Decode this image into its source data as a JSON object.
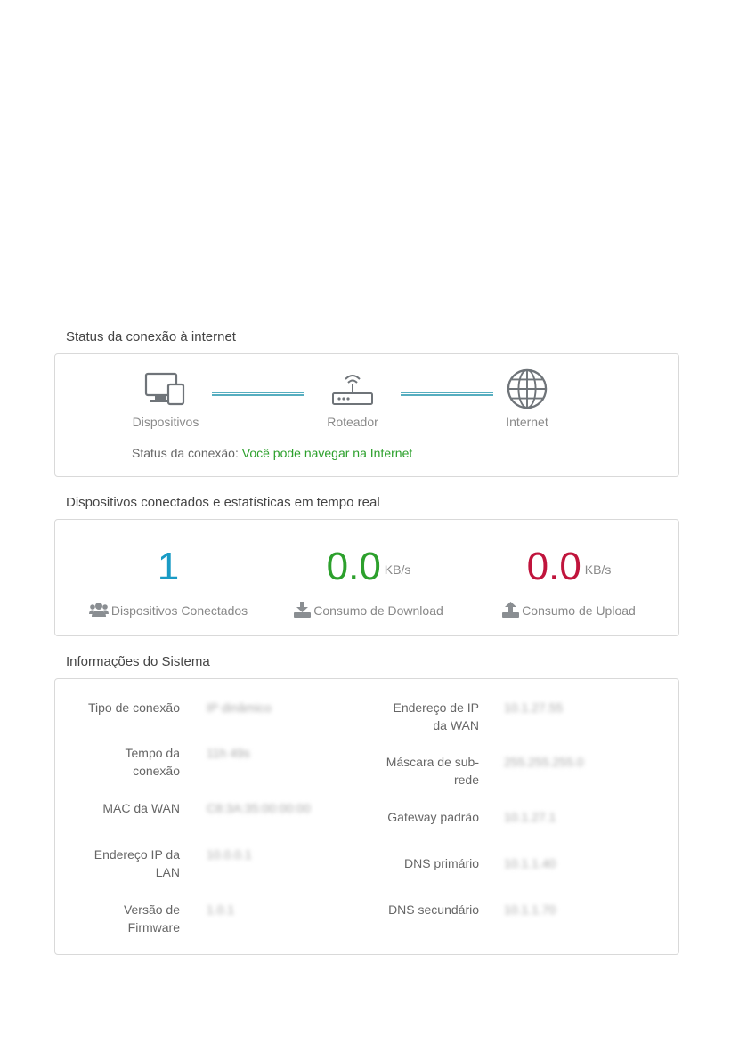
{
  "connection_status": {
    "title": "Status da conexão à internet",
    "devices_label": "Dispositivos",
    "router_label": "Roteador",
    "internet_label": "Internet",
    "status_prefix": "Status da conexão:",
    "status_value": "Você pode navegar na Internet",
    "status_color": "#2ca02c",
    "link_color": "#3aa1b6"
  },
  "stats": {
    "title": "Dispositivos conectados e estatísticas em tempo real",
    "connected": {
      "value": "1",
      "caption": "Dispositivos Conectados",
      "color": "#1a9bc5",
      "icon": "users-icon"
    },
    "download": {
      "value": "0.0",
      "unit": "KB/s",
      "caption": "Consumo de Download",
      "color": "#2ca02c",
      "icon": "download-icon"
    },
    "upload": {
      "value": "0.0",
      "unit": "KB/s",
      "caption": "Consumo de Upload",
      "color": "#c0143c",
      "icon": "upload-icon"
    }
  },
  "system_info": {
    "title": "Informações do Sistema",
    "left": [
      {
        "key": "Tipo de conexão",
        "value": "IP dinâmico"
      },
      {
        "key": "Tempo da conexão",
        "value": "11h 49s"
      },
      {
        "key": "MAC da WAN",
        "value": "C8:3A:35:00:00:00"
      },
      {
        "key": "Endereço IP da LAN",
        "value": "10.0.0.1"
      },
      {
        "key": "Versão de Firmware",
        "value": "1.0.1"
      }
    ],
    "right": [
      {
        "key": "Endereço de IP da WAN",
        "value": "10.1.27.55"
      },
      {
        "key": "Máscara de sub-rede",
        "value": "255.255.255.0"
      },
      {
        "key": "Gateway padrão",
        "value": "10.1.27.1"
      },
      {
        "key": "DNS primário",
        "value": "10.1.1.40"
      },
      {
        "key": "DNS secundário",
        "value": "10.1.1.70"
      }
    ]
  }
}
